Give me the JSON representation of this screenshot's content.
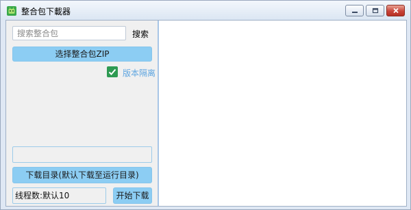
{
  "window": {
    "title": "整合包下載器"
  },
  "icons": {
    "app": "android-icon",
    "minimize": "minimize-icon",
    "maximize": "maximize-icon",
    "close": "close-icon",
    "check": "checkmark-icon"
  },
  "colors": {
    "button_blue": "#8ccdf3",
    "checkbox_green": "#2e9a52",
    "checkbox_label": "#5ea5e0",
    "close_red": "#c8443a",
    "divider_blue": "#a8c6e6"
  },
  "left_panel": {
    "search": {
      "placeholder": "搜索整合包",
      "value": "",
      "label": "搜索"
    },
    "select_zip_label": "选择整合包ZIP",
    "version_isolation": {
      "label": "版本隔离",
      "checked": true
    },
    "status_field_value": "",
    "download_dir_label": "下载目录(默认下载至运行目录)",
    "thread_count_value": "线程数:默认10",
    "start_download_label": "开始下载"
  }
}
